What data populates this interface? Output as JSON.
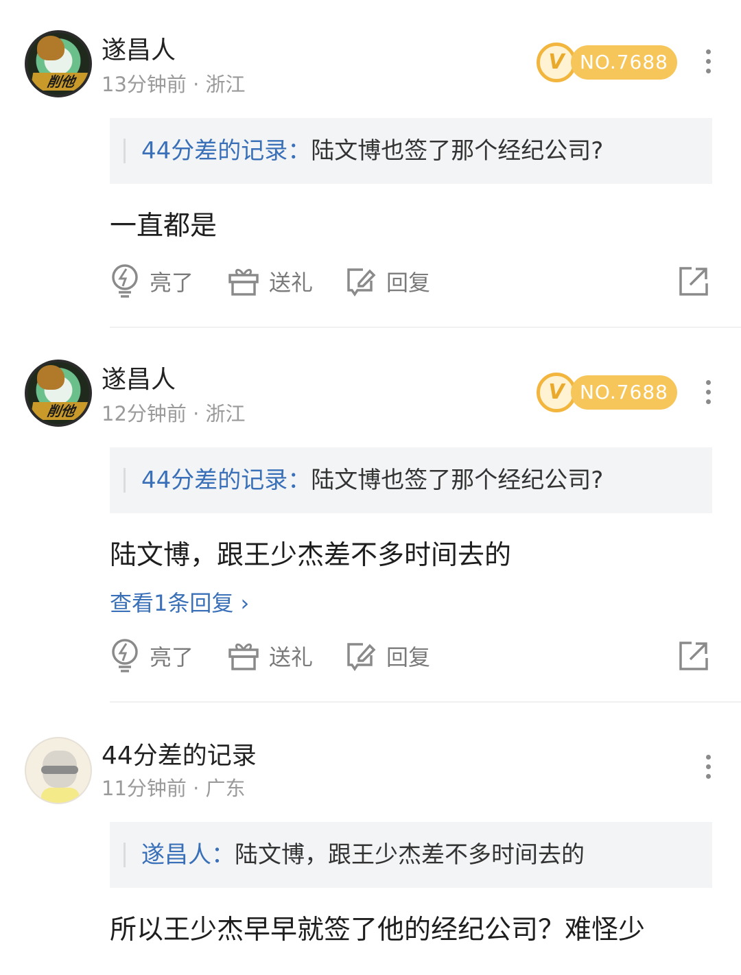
{
  "comments": [
    {
      "username": "遂昌人",
      "meta": "13分钟前 · 浙江",
      "badge": "NO.7688",
      "avatar_badge": "削他",
      "quote_name": "44分差的记录：",
      "quote_text": "陆文博也签了那个经纪公司?",
      "text": "一直都是"
    },
    {
      "username": "遂昌人",
      "meta": "12分钟前 · 浙江",
      "badge": "NO.7688",
      "avatar_badge": "削他",
      "quote_name": "44分差的记录：",
      "quote_text": "陆文博也签了那个经纪公司?",
      "text": "陆文博，跟王少杰差不多时间去的",
      "view_replies": "查看1条回复 ›"
    },
    {
      "username": "44分差的记录",
      "meta": "11分钟前 · 广东",
      "quote_name": "遂昌人：",
      "quote_text": "陆文博，跟王少杰差不多时间去的",
      "text": "所以王少杰早早就签了他的经纪公司？难怪少"
    }
  ],
  "actions": {
    "like_label": "亮了",
    "gift_label": "送礼",
    "reply_label": "回复"
  },
  "colors": {
    "accent_blue": "#3a70b8",
    "vip_gold": "#f7c65a",
    "muted": "#9a9a9a"
  }
}
